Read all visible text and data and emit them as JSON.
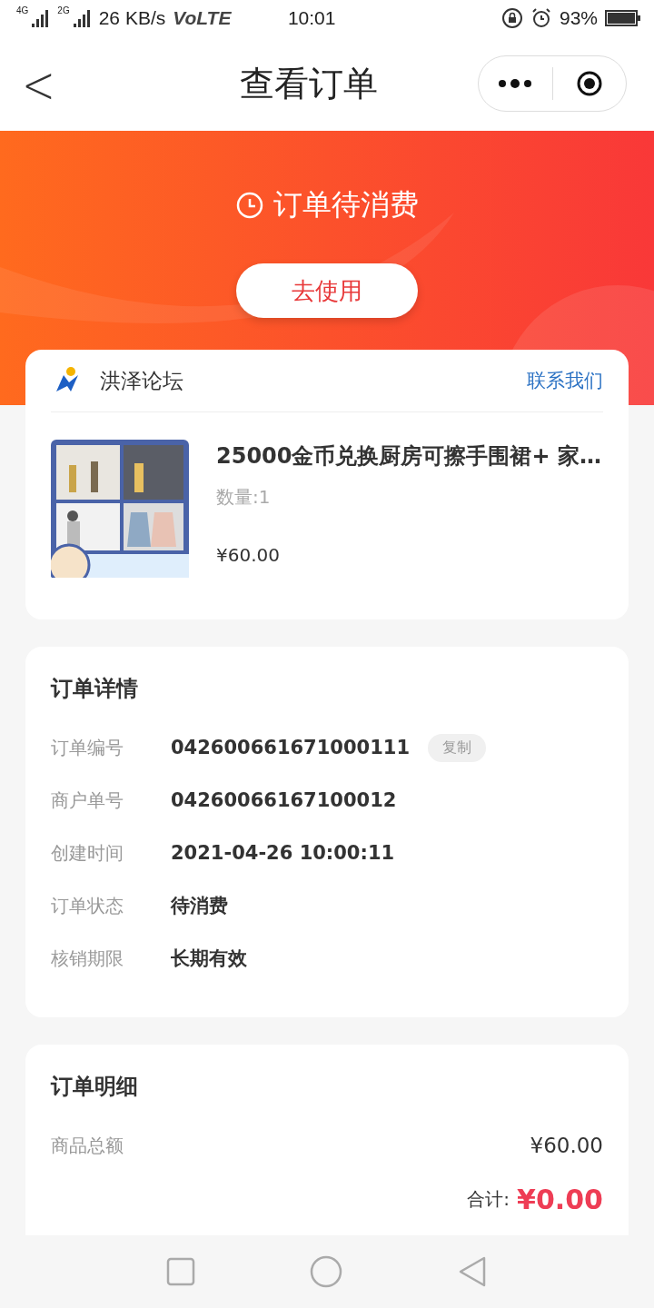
{
  "status_bar": {
    "networks": [
      "4G",
      "2G"
    ],
    "speed": "26 KB/s",
    "volte": "VoLTE",
    "time": "10:01",
    "battery": "93%"
  },
  "nav": {
    "back": "<",
    "title": "查看订单"
  },
  "banner": {
    "status": "订单待消费",
    "button": "去使用"
  },
  "store": {
    "name": "洪泽论坛",
    "contact": "联系我们"
  },
  "product": {
    "kind": "picture",
    "title": "25000金币兑换厨房可擦手围裙+ 家…",
    "quantity": "数量:1",
    "price": "¥60.00"
  },
  "details": {
    "title": "订单详情",
    "rows": [
      {
        "label": "订单编号",
        "value": "042600661671000111",
        "action": "复制"
      },
      {
        "label": "商户单号",
        "value": "04260066167100012"
      },
      {
        "label": "创建时间",
        "value": "2021-04-26 10:00:11"
      },
      {
        "label": "订单状态",
        "value": "待消费"
      },
      {
        "label": "核销期限",
        "value": "长期有效"
      }
    ]
  },
  "summary": {
    "title": "订单明细",
    "rows": [
      {
        "label": "商品总额",
        "value": "¥60.00"
      }
    ],
    "total_label": "合计:",
    "total": "¥0.00"
  }
}
